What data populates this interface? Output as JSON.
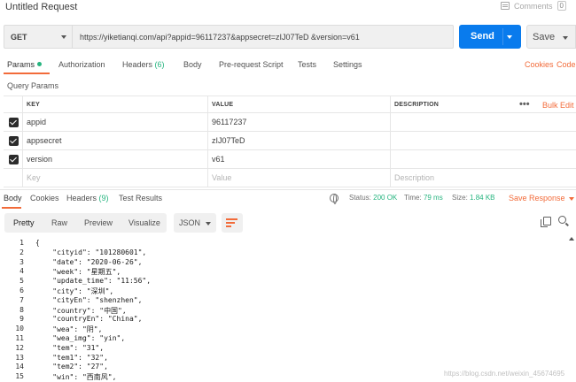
{
  "window": {
    "title": "Untitled Request",
    "comments_label": "Comments",
    "comments_count": "0"
  },
  "request": {
    "method": "GET",
    "url": "https://yiketianqi.com/api?appid=96117237&appsecret=zIJ07TeD &version=v61",
    "send_label": "Send",
    "save_label": "Save"
  },
  "req_tabs": {
    "params": "Params",
    "authorization": "Authorization",
    "headers": "Headers",
    "headers_count": "(6)",
    "body": "Body",
    "prerequest": "Pre-request Script",
    "tests": "Tests",
    "settings": "Settings",
    "cookies": "Cookies",
    "code": "Code"
  },
  "query_params": {
    "title": "Query Params",
    "headers": {
      "key": "KEY",
      "value": "VALUE",
      "description": "DESCRIPTION",
      "bulk_edit": "Bulk Edit",
      "more": "•••"
    },
    "rows": [
      {
        "key": "appid",
        "value": "96117237",
        "checked": true
      },
      {
        "key": "appsecret",
        "value": "zIJ07TeD",
        "checked": true
      },
      {
        "key": "version",
        "value": "v61",
        "checked": true
      }
    ],
    "placeholder": {
      "key": "Key",
      "value": "Value",
      "description": "Description"
    }
  },
  "response": {
    "tabs": {
      "body": "Body",
      "cookies": "Cookies",
      "headers": "Headers",
      "headers_count": "(9)",
      "test_results": "Test Results"
    },
    "status_label": "Status:",
    "status_value": "200 OK",
    "time_label": "Time:",
    "time_value": "79 ms",
    "size_label": "Size:",
    "size_value": "1.84 KB",
    "save_response": "Save Response",
    "views": {
      "pretty": "Pretty",
      "raw": "Raw",
      "preview": "Preview",
      "visualize": "Visualize"
    },
    "format": "JSON",
    "lines": [
      {
        "n": "1",
        "t": "{"
      },
      {
        "n": "2",
        "t": "    \"cityid\": \"101280601\","
      },
      {
        "n": "3",
        "t": "    \"date\": \"2020-06-26\","
      },
      {
        "n": "4",
        "t": "    \"week\": \"星期五\","
      },
      {
        "n": "5",
        "t": "    \"update_time\": \"11:56\","
      },
      {
        "n": "6",
        "t": "    \"city\": \"深圳\","
      },
      {
        "n": "7",
        "t": "    \"cityEn\": \"shenzhen\","
      },
      {
        "n": "8",
        "t": "    \"country\": \"中国\","
      },
      {
        "n": "9",
        "t": "    \"countryEn\": \"China\","
      },
      {
        "n": "10",
        "t": "    \"wea\": \"阴\","
      },
      {
        "n": "11",
        "t": "    \"wea_img\": \"yin\","
      },
      {
        "n": "12",
        "t": "    \"tem\": \"31\","
      },
      {
        "n": "13",
        "t": "    \"tem1\": \"32\","
      },
      {
        "n": "14",
        "t": "    \"tem2\": \"27\","
      },
      {
        "n": "15",
        "t": "    \"win\": \"西南风\","
      }
    ]
  },
  "watermark": "https://blog.csdn.net/weixin_45674695",
  "colors": {
    "accent": "#f26b3a",
    "send": "#097bed",
    "status_ok": "#26b47f"
  }
}
